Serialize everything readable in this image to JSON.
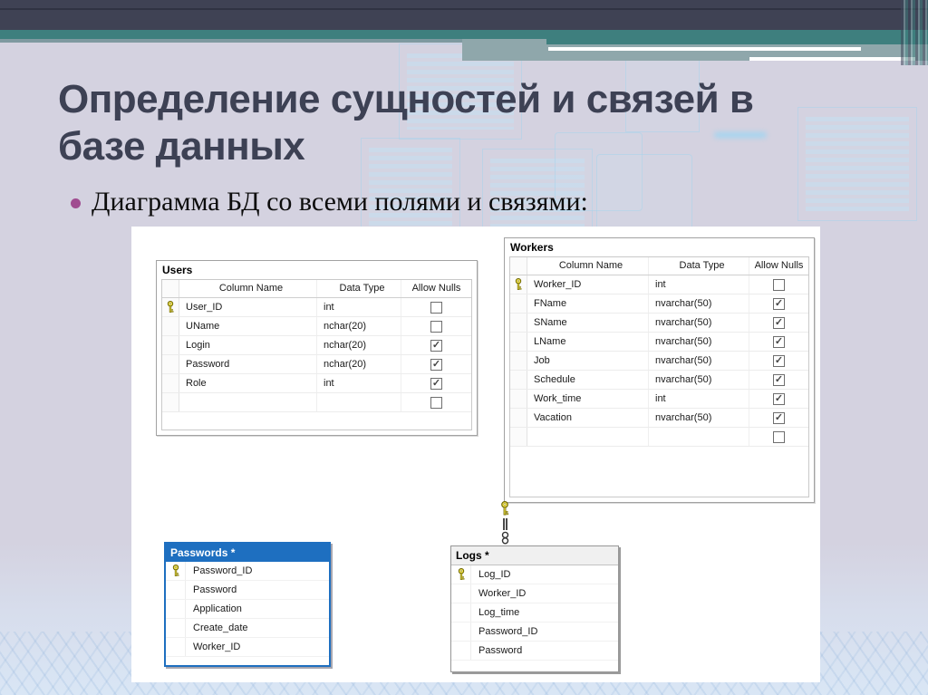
{
  "slide": {
    "title": "Определение сущностей и связей в базе данных",
    "bullet_text": "Диаграмма БД со всеми полями и связями:"
  },
  "colors": {
    "top_bar": "#3F4254",
    "teal_stripe": "#3E7F7E",
    "muted_teal": "#8FA7AB",
    "background": "#D4D2E0",
    "title_text": "#3D4154",
    "bullet_dot": "#A04C90",
    "selected_table_blue": "#1E6FC0",
    "primary_key_yellow": "#F2E24B"
  },
  "diagram": {
    "tables": [
      {
        "id": "users",
        "name": "Users",
        "style": "grid",
        "headers": [
          "Column Name",
          "Data Type",
          "Allow Nulls"
        ],
        "rows": [
          {
            "key": true,
            "name": "User_ID",
            "type": "int",
            "allow_nulls": false
          },
          {
            "key": false,
            "name": "UName",
            "type": "nchar(20)",
            "allow_nulls": false
          },
          {
            "key": false,
            "name": "Login",
            "type": "nchar(20)",
            "allow_nulls": true
          },
          {
            "key": false,
            "name": "Password",
            "type": "nchar(20)",
            "allow_nulls": true
          },
          {
            "key": false,
            "name": "Role",
            "type": "int",
            "allow_nulls": true
          },
          {
            "key": false,
            "name": "",
            "type": "",
            "allow_nulls": false
          }
        ]
      },
      {
        "id": "workers",
        "name": "Workers",
        "style": "grid",
        "headers": [
          "Column Name",
          "Data Type",
          "Allow Nulls"
        ],
        "rows": [
          {
            "key": true,
            "name": "Worker_ID",
            "type": "int",
            "allow_nulls": false
          },
          {
            "key": false,
            "name": "FName",
            "type": "nvarchar(50)",
            "allow_nulls": true
          },
          {
            "key": false,
            "name": "SName",
            "type": "nvarchar(50)",
            "allow_nulls": true
          },
          {
            "key": false,
            "name": "LName",
            "type": "nvarchar(50)",
            "allow_nulls": true
          },
          {
            "key": false,
            "name": "Job",
            "type": "nvarchar(50)",
            "allow_nulls": true
          },
          {
            "key": false,
            "name": "Schedule",
            "type": "nvarchar(50)",
            "allow_nulls": true
          },
          {
            "key": false,
            "name": "Work_time",
            "type": "int",
            "allow_nulls": true
          },
          {
            "key": false,
            "name": "Vacation",
            "type": "nvarchar(50)",
            "allow_nulls": true
          },
          {
            "key": false,
            "name": "",
            "type": "",
            "allow_nulls": false
          }
        ]
      },
      {
        "id": "passwords",
        "name": "Passwords *",
        "style": "list",
        "selected": true,
        "rows": [
          {
            "key": true,
            "name": "Password_ID"
          },
          {
            "key": false,
            "name": "Password"
          },
          {
            "key": false,
            "name": "Application"
          },
          {
            "key": false,
            "name": "Create_date"
          },
          {
            "key": false,
            "name": "Worker_ID"
          }
        ]
      },
      {
        "id": "logs",
        "name": "Logs *",
        "style": "list",
        "selected": false,
        "rows": [
          {
            "key": true,
            "name": "Log_ID"
          },
          {
            "key": false,
            "name": "Worker_ID"
          },
          {
            "key": false,
            "name": "Log_time"
          },
          {
            "key": false,
            "name": "Password_ID"
          },
          {
            "key": false,
            "name": "Password"
          }
        ]
      }
    ],
    "relationship": {
      "from_table": "Workers",
      "to_table": "Logs *",
      "cardinality": "one-to-many",
      "one_end_icon": "key-icon",
      "many_end_icon": "infinity-icon"
    }
  }
}
